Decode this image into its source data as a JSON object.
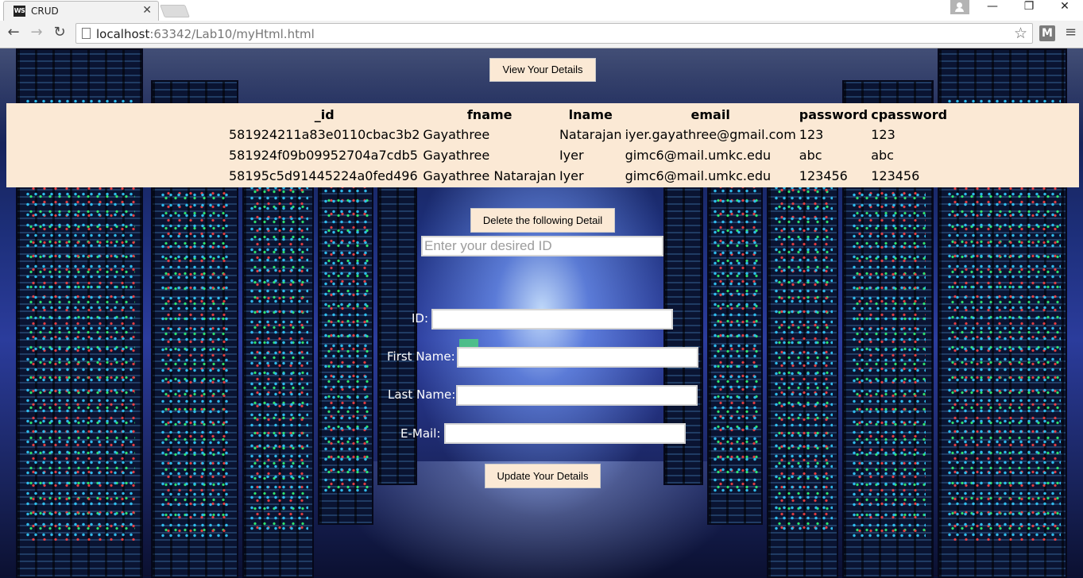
{
  "browser": {
    "tab_title": "CRUD",
    "favicon_text": "WS",
    "url_host": "localhost",
    "url_rest": ":63342/Lab10/myHtml.html",
    "extension_label": "M",
    "icons": {
      "back": "←",
      "forward": "→",
      "reload": "↻",
      "star": "☆",
      "menu": "≡",
      "tab_close": "✕",
      "minimize": "—",
      "restore": "❐",
      "close": "✕"
    }
  },
  "page": {
    "view_button": "View Your Details",
    "table": {
      "headers": [
        "_id",
        "fname",
        "lname",
        "email",
        "password",
        "cpassword"
      ],
      "rows": [
        [
          "581924211a83e0110cbac3b2",
          "Gayathree",
          "Natarajan",
          "iyer.gayathree@gmail.com",
          "123",
          "123"
        ],
        [
          "581924f09b09952704a7cdb5",
          "Gayathree",
          "Iyer",
          "gimc6@mail.umkc.edu",
          "abc",
          "abc"
        ],
        [
          "58195c5d91445224a0fed496",
          "Gayathree Natarajan",
          "Iyer",
          "gimc6@mail.umkc.edu",
          "123456",
          "123456"
        ]
      ]
    },
    "delete_button": "Delete the following Detail",
    "delete_input": {
      "placeholder": "Enter your desired ID",
      "value": ""
    },
    "form": {
      "id_label": "ID:",
      "first_name_label": "First Name:",
      "last_name_label": "Last Name:",
      "email_label": "E-Mail:",
      "id_value": "",
      "first_name_value": "",
      "last_name_value": "",
      "email_value": ""
    },
    "update_button": "Update Your Details"
  }
}
